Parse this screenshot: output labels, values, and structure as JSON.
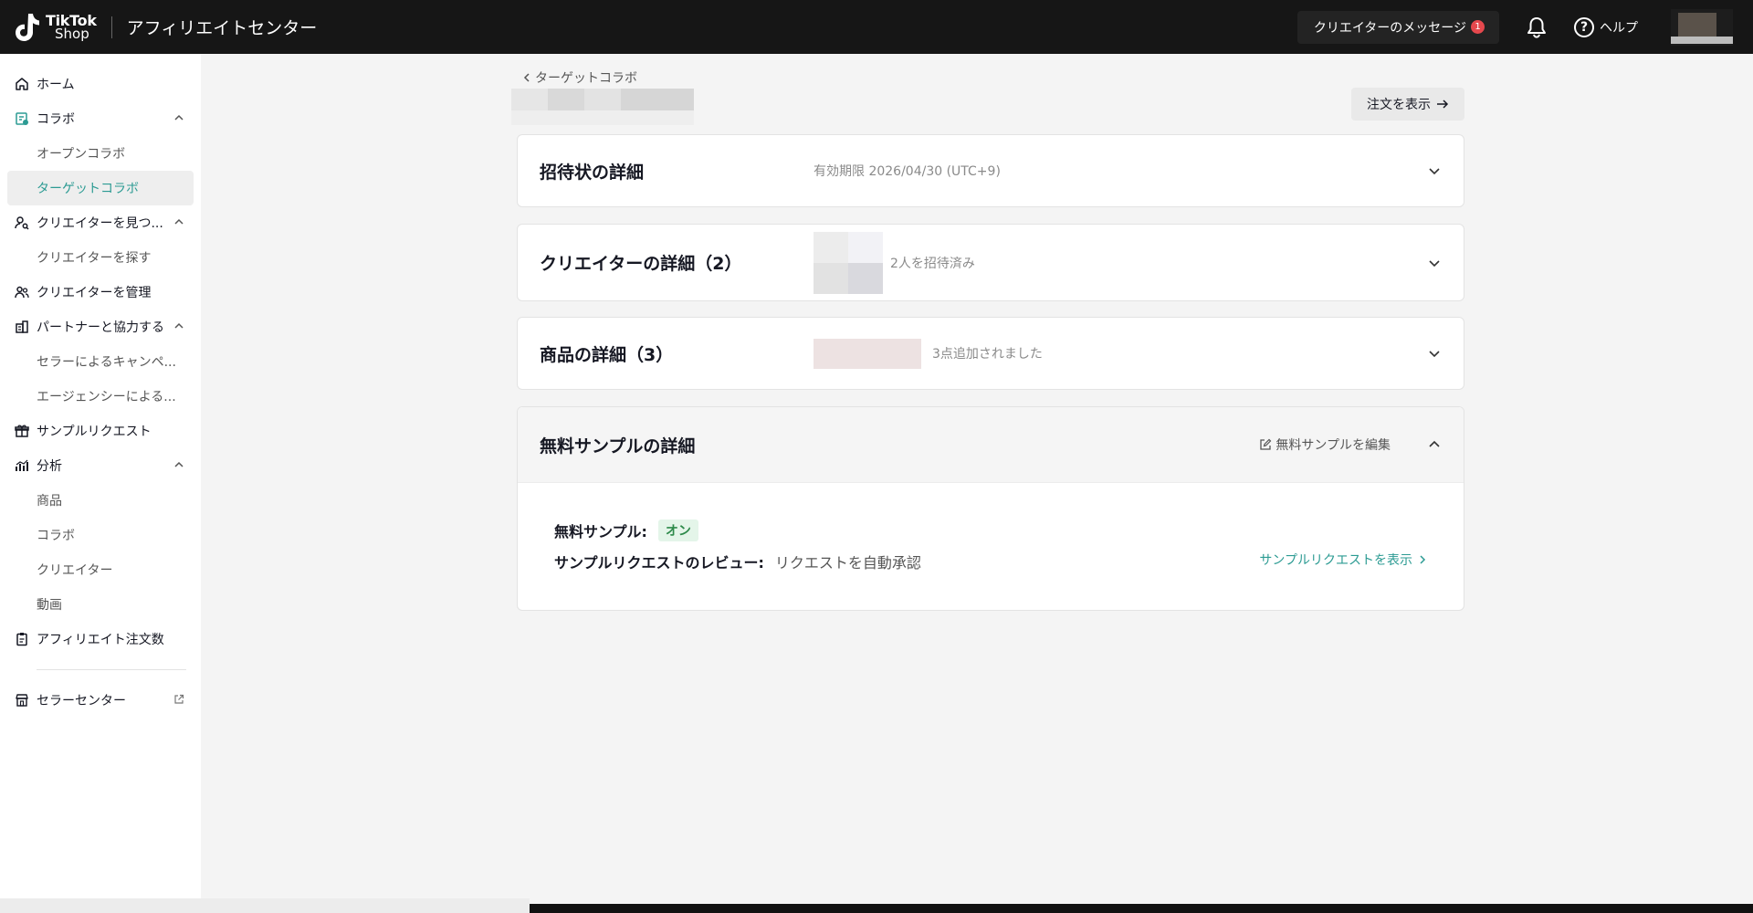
{
  "header": {
    "logo_line1": "TikTok",
    "logo_line2": "Shop",
    "app_title": "アフィリエイトセンター",
    "messages_label": "クリエイターのメッセージ",
    "messages_badge": "1",
    "help_label": "ヘルプ"
  },
  "sidebar": {
    "home": "ホーム",
    "collab": "コラボ",
    "open_collab": "オープンコラボ",
    "target_collab": "ターゲットコラボ",
    "find_creators": "クリエイターを見つ...",
    "search_creators": "クリエイターを探す",
    "manage_creators": "クリエイターを管理",
    "partners": "パートナーと協力する",
    "seller_campaigns": "セラーによるキャンペ...",
    "agency": "エージェンシーによる...",
    "sample_requests": "サンプルリクエスト",
    "analytics": "分析",
    "products": "商品",
    "collab_sub": "コラボ",
    "creators": "クリエイター",
    "videos": "動画",
    "affiliate_orders": "アフィリエイト注文数",
    "seller_center": "セラーセンター"
  },
  "main": {
    "breadcrumb": "ターゲットコラボ",
    "view_orders": "注文を表示",
    "invitation": {
      "title": "招待状の詳細",
      "subtitle": "有効期限 2026/04/30 (UTC+9)"
    },
    "creators": {
      "title": "クリエイターの詳細（2）",
      "subtitle": "2人を招待済み"
    },
    "products": {
      "title": "商品の詳細（3）",
      "subtitle": "3点追加されました"
    },
    "free_sample": {
      "title": "無料サンプルの詳細",
      "edit_label": "無料サンプルを編集",
      "sample_label": "無料サンプル:",
      "sample_value": "オン",
      "review_label": "サンプルリクエストのレビュー:",
      "review_value": "リクエストを自動承認",
      "view_requests": "サンプルリクエストを表示"
    }
  },
  "colors": {
    "accent": "#2c9b93",
    "topbar": "#161616",
    "badge": "#e5484d",
    "tag_on_bg": "#e4f5e9",
    "tag_on_fg": "#2d8a4a"
  }
}
